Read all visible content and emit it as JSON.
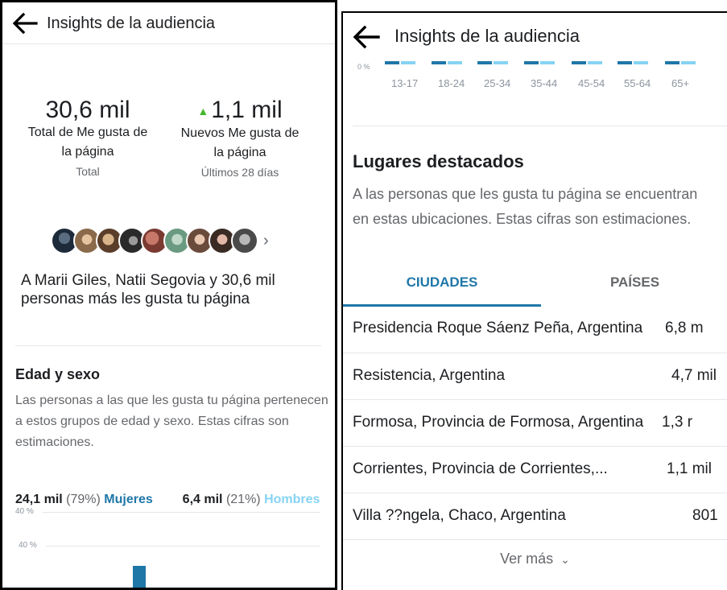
{
  "left": {
    "header": {
      "title": "Insights de la audiencia"
    },
    "total_likes": {
      "value": "30,6 mil",
      "label_line1": "Total de Me gusta de",
      "label_line2": "la página",
      "sub": "Total"
    },
    "new_likes": {
      "value": "1,1 mil",
      "label_line1": "Nuevos Me gusta de",
      "label_line2": "la página",
      "sub": "Últimos 28 días"
    },
    "liked_by_text": "A Marii Giles, Natii Segovia y 30,6 mil personas más les gusta tu página",
    "age_gender": {
      "title": "Edad y sexo",
      "description": "Las personas a las que les gusta tu página pertenecen a estos grupos de edad y sexo. Estas cifras son estimaciones.",
      "women_count": "24,1 mil",
      "women_pct": "(79%)",
      "women_label": "Mujeres",
      "men_count": "6,4 mil",
      "men_pct": "(21%)",
      "men_label": "Hombres",
      "axis_label_1": "40 %",
      "axis_label_2": "40 %"
    }
  },
  "right": {
    "header": {
      "title": "Insights de la audiencia"
    },
    "age_axis_zero": "0 %",
    "age_groups": [
      "13-17",
      "18-24",
      "25-34",
      "35-44",
      "45-54",
      "55-64",
      "65+"
    ],
    "places": {
      "title": "Lugares destacados",
      "description": "A las personas que les gusta tu página se encuentran en estas ubicaciones. Estas cifras son estimaciones.",
      "tabs": [
        "CIUDADES",
        "PAÍSES"
      ],
      "cities": [
        {
          "name": "Presidencia Roque Sáenz Peña, Argentina",
          "value": "6,8 m"
        },
        {
          "name": "Resistencia, Argentina",
          "value": "4,7 mil"
        },
        {
          "name": "Formosa, Provincia de Formosa, Argentina",
          "value": "1,3 r"
        },
        {
          "name": "Corrientes, Provincia de Corrientes,...",
          "value": "1,1 mil"
        },
        {
          "name": "Villa ??ngela, Chaco, Argentina",
          "value": "801"
        }
      ],
      "see_more": "Ver más"
    }
  },
  "colors": {
    "women": "#1f77a8",
    "men": "#86d3f2",
    "growth": "#42b72a",
    "text": "#1c1e21",
    "muted": "#65676b"
  }
}
